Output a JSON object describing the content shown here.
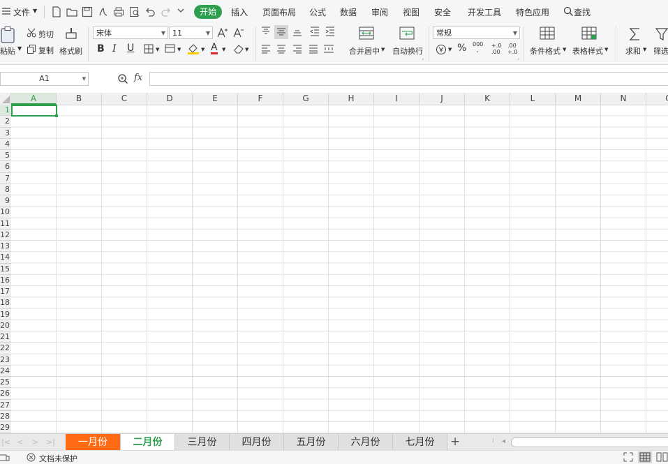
{
  "menubar": {
    "file": "文件",
    "tabs": [
      "开始",
      "插入",
      "页面布局",
      "公式",
      "数据",
      "审阅",
      "视图",
      "安全",
      "开发工具",
      "特色应用"
    ],
    "search": "查找",
    "accent": "#2e9e4f"
  },
  "ribbon": {
    "paste": "粘贴",
    "cut": "剪切",
    "copy": "复制",
    "format_painter": "格式刷",
    "font_name": "宋体",
    "font_size": "11",
    "bold": "B",
    "italic": "I",
    "underline": "U",
    "font_color_glyph": "A",
    "merge_center": "合并居中",
    "wrap_text": "自动换行",
    "number_format": "常规",
    "percent": "%",
    "thousands": "000",
    "inc_decimal": "+.0 .00",
    "dec_decimal": ".00 +.0",
    "cond_format": "条件格式",
    "table_style": "表格样式",
    "sum": "求和",
    "filter": "筛选"
  },
  "formula": {
    "cell_ref": "A1",
    "fx": "fx",
    "value": ""
  },
  "grid": {
    "columns": [
      "A",
      "B",
      "C",
      "D",
      "E",
      "F",
      "G",
      "H",
      "I",
      "J",
      "K",
      "L",
      "M",
      "N",
      "O"
    ],
    "rows": [
      "1",
      "2",
      "3",
      "4",
      "5",
      "6",
      "7",
      "8",
      "9",
      "10",
      "11",
      "12",
      "13",
      "14",
      "15",
      "16",
      "17",
      "18",
      "19",
      "20",
      "21",
      "22",
      "23",
      "24",
      "25",
      "26",
      "27",
      "28",
      "29"
    ],
    "selected_cell": "A1"
  },
  "sheets": {
    "tabs": [
      "一月份",
      "二月份",
      "三月份",
      "四月份",
      "五月份",
      "六月份",
      "七月份"
    ],
    "active": "二月份",
    "highlight_color": "#ff6a13",
    "add": "+"
  },
  "status": {
    "protection": "文档未保护"
  }
}
